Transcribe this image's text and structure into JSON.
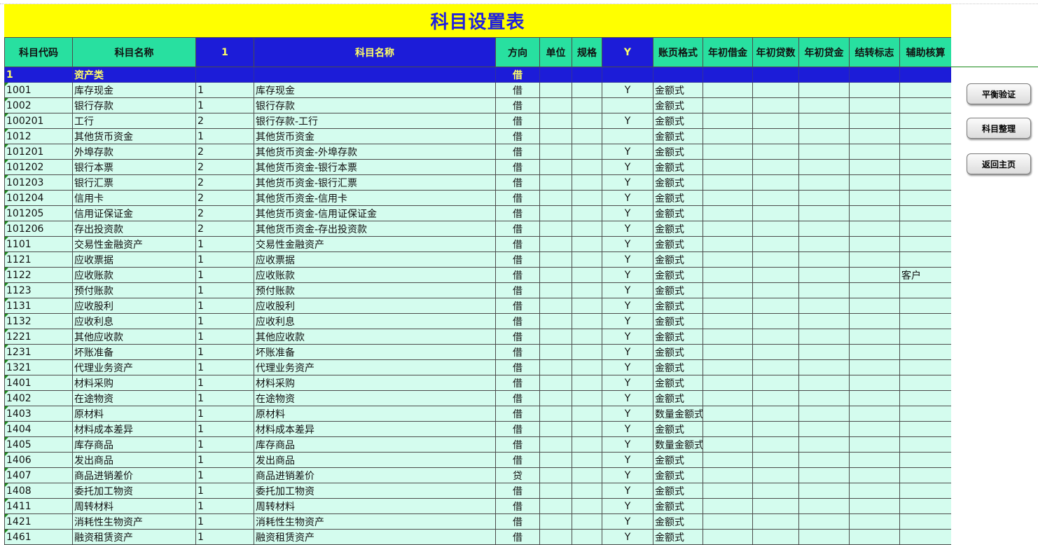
{
  "title": "科目设置表",
  "headers": [
    "科目代码",
    "科目名称",
    "1",
    "科目名称",
    "方向",
    "单位",
    "规格",
    "Y",
    "账页格式",
    "年初借金",
    "年初贷数",
    "年初贷金",
    "结转标志",
    "辅助核算"
  ],
  "category_row": {
    "code": "1",
    "name": "资产类",
    "direction": "借"
  },
  "rows": [
    {
      "code": "1001",
      "name": "库存现金",
      "level": "1",
      "full": "库存现金",
      "dir": "借",
      "y": "Y",
      "fmt": "金额式",
      "aux": ""
    },
    {
      "code": "1002",
      "name": "银行存款",
      "level": "1",
      "full": "银行存款",
      "dir": "借",
      "y": "",
      "fmt": "金额式",
      "aux": ""
    },
    {
      "code": "100201",
      "name": "工行",
      "level": "2",
      "full": "银行存款-工行",
      "dir": "借",
      "y": "Y",
      "fmt": "金额式",
      "aux": ""
    },
    {
      "code": "1012",
      "name": "其他货币资金",
      "level": "1",
      "full": "其他货币资金",
      "dir": "借",
      "y": "",
      "fmt": "金额式",
      "aux": ""
    },
    {
      "code": "101201",
      "name": "外埠存款",
      "level": "2",
      "full": "其他货币资金-外埠存款",
      "dir": "借",
      "y": "Y",
      "fmt": "金额式",
      "aux": ""
    },
    {
      "code": "101202",
      "name": "银行本票",
      "level": "2",
      "full": "其他货币资金-银行本票",
      "dir": "借",
      "y": "Y",
      "fmt": "金额式",
      "aux": ""
    },
    {
      "code": "101203",
      "name": "银行汇票",
      "level": "2",
      "full": "其他货币资金-银行汇票",
      "dir": "借",
      "y": "Y",
      "fmt": "金额式",
      "aux": ""
    },
    {
      "code": "101204",
      "name": "信用卡",
      "level": "2",
      "full": "其他货币资金-信用卡",
      "dir": "借",
      "y": "Y",
      "fmt": "金额式",
      "aux": ""
    },
    {
      "code": "101205",
      "name": "信用证保证金",
      "level": "2",
      "full": "其他货币资金-信用证保证金",
      "dir": "借",
      "y": "Y",
      "fmt": "金额式",
      "aux": ""
    },
    {
      "code": "101206",
      "name": "存出投资款",
      "level": "2",
      "full": "其他货币资金-存出投资款",
      "dir": "借",
      "y": "Y",
      "fmt": "金额式",
      "aux": ""
    },
    {
      "code": "1101",
      "name": "交易性金融资产",
      "level": "1",
      "full": "交易性金融资产",
      "dir": "借",
      "y": "Y",
      "fmt": "金额式",
      "aux": ""
    },
    {
      "code": "1121",
      "name": "应收票据",
      "level": "1",
      "full": "应收票据",
      "dir": "借",
      "y": "Y",
      "fmt": "金额式",
      "aux": ""
    },
    {
      "code": "1122",
      "name": "应收账款",
      "level": "1",
      "full": "应收账款",
      "dir": "借",
      "y": "Y",
      "fmt": "金额式",
      "aux": "客户"
    },
    {
      "code": "1123",
      "name": "预付账款",
      "level": "1",
      "full": "预付账款",
      "dir": "借",
      "y": "Y",
      "fmt": "金额式",
      "aux": ""
    },
    {
      "code": "1131",
      "name": "应收股利",
      "level": "1",
      "full": "应收股利",
      "dir": "借",
      "y": "Y",
      "fmt": "金额式",
      "aux": ""
    },
    {
      "code": "1132",
      "name": "应收利息",
      "level": "1",
      "full": "应收利息",
      "dir": "借",
      "y": "Y",
      "fmt": "金额式",
      "aux": ""
    },
    {
      "code": "1221",
      "name": "其他应收款",
      "level": "1",
      "full": "其他应收款",
      "dir": "借",
      "y": "Y",
      "fmt": "金额式",
      "aux": ""
    },
    {
      "code": "1231",
      "name": "坏账准备",
      "level": "1",
      "full": "坏账准备",
      "dir": "借",
      "y": "Y",
      "fmt": "金额式",
      "aux": ""
    },
    {
      "code": "1321",
      "name": "代理业务资产",
      "level": "1",
      "full": "代理业务资产",
      "dir": "借",
      "y": "Y",
      "fmt": "金额式",
      "aux": ""
    },
    {
      "code": "1401",
      "name": "材料采购",
      "level": "1",
      "full": "材料采购",
      "dir": "借",
      "y": "Y",
      "fmt": "金额式",
      "aux": ""
    },
    {
      "code": "1402",
      "name": "在途物资",
      "level": "1",
      "full": "在途物资",
      "dir": "借",
      "y": "Y",
      "fmt": "金额式",
      "aux": ""
    },
    {
      "code": "1403",
      "name": "原材料",
      "level": "1",
      "full": "原材料",
      "dir": "借",
      "y": "Y",
      "fmt": "数量金额式",
      "aux": ""
    },
    {
      "code": "1404",
      "name": "材料成本差异",
      "level": "1",
      "full": "材料成本差异",
      "dir": "借",
      "y": "Y",
      "fmt": "金额式",
      "aux": ""
    },
    {
      "code": "1405",
      "name": "库存商品",
      "level": "1",
      "full": "库存商品",
      "dir": "借",
      "y": "Y",
      "fmt": "数量金额式",
      "aux": ""
    },
    {
      "code": "1406",
      "name": "发出商品",
      "level": "1",
      "full": "发出商品",
      "dir": "借",
      "y": "Y",
      "fmt": "金额式",
      "aux": ""
    },
    {
      "code": "1407",
      "name": "商品进销差价",
      "level": "1",
      "full": "商品进销差价",
      "dir": "贷",
      "y": "Y",
      "fmt": "金额式",
      "aux": ""
    },
    {
      "code": "1408",
      "name": "委托加工物资",
      "level": "1",
      "full": "委托加工物资",
      "dir": "借",
      "y": "Y",
      "fmt": "金额式",
      "aux": ""
    },
    {
      "code": "1411",
      "name": "周转材料",
      "level": "1",
      "full": "周转材料",
      "dir": "借",
      "y": "Y",
      "fmt": "金额式",
      "aux": ""
    },
    {
      "code": "1421",
      "name": "消耗性生物资产",
      "level": "1",
      "full": "消耗性生物资产",
      "dir": "借",
      "y": "Y",
      "fmt": "金额式",
      "aux": ""
    },
    {
      "code": "1461",
      "name": "融资租赁资产",
      "level": "1",
      "full": "融资租赁资产",
      "dir": "借",
      "y": "Y",
      "fmt": "金额式",
      "aux": ""
    }
  ],
  "buttons": {
    "balance": "平衡验证",
    "organize": "科目整理",
    "home": "返回主页"
  },
  "colors": {
    "title_bg": "#ffff00",
    "title_text": "#1f1fe0",
    "header_bg": "#28e0a0",
    "category_bg": "#1c1cd8",
    "row_bg": "#d4fcee"
  }
}
